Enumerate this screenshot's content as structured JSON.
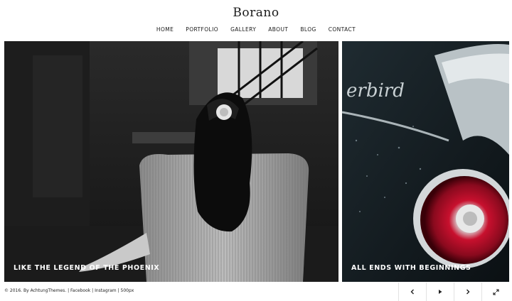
{
  "site": {
    "logo": "Borano"
  },
  "nav": {
    "items": [
      "HOME",
      "PORTFOLIO",
      "GALLERY",
      "ABOUT",
      "BLOG",
      "CONTACT"
    ]
  },
  "slides": [
    {
      "caption": "LIKE THE LEGEND OF THE PHOENIX"
    },
    {
      "caption": "ALL ENDS WITH BEGINNINGS"
    }
  ],
  "footer": {
    "copyright": "© 2016. By AchtungThemes. |",
    "links": [
      "Facebook",
      "Instagram",
      "500px"
    ],
    "separator": "|"
  },
  "controls": {
    "prev_icon": "chevron-left-icon",
    "play_icon": "play-icon",
    "next_icon": "chevron-right-icon",
    "fullscreen_icon": "expand-icon"
  }
}
